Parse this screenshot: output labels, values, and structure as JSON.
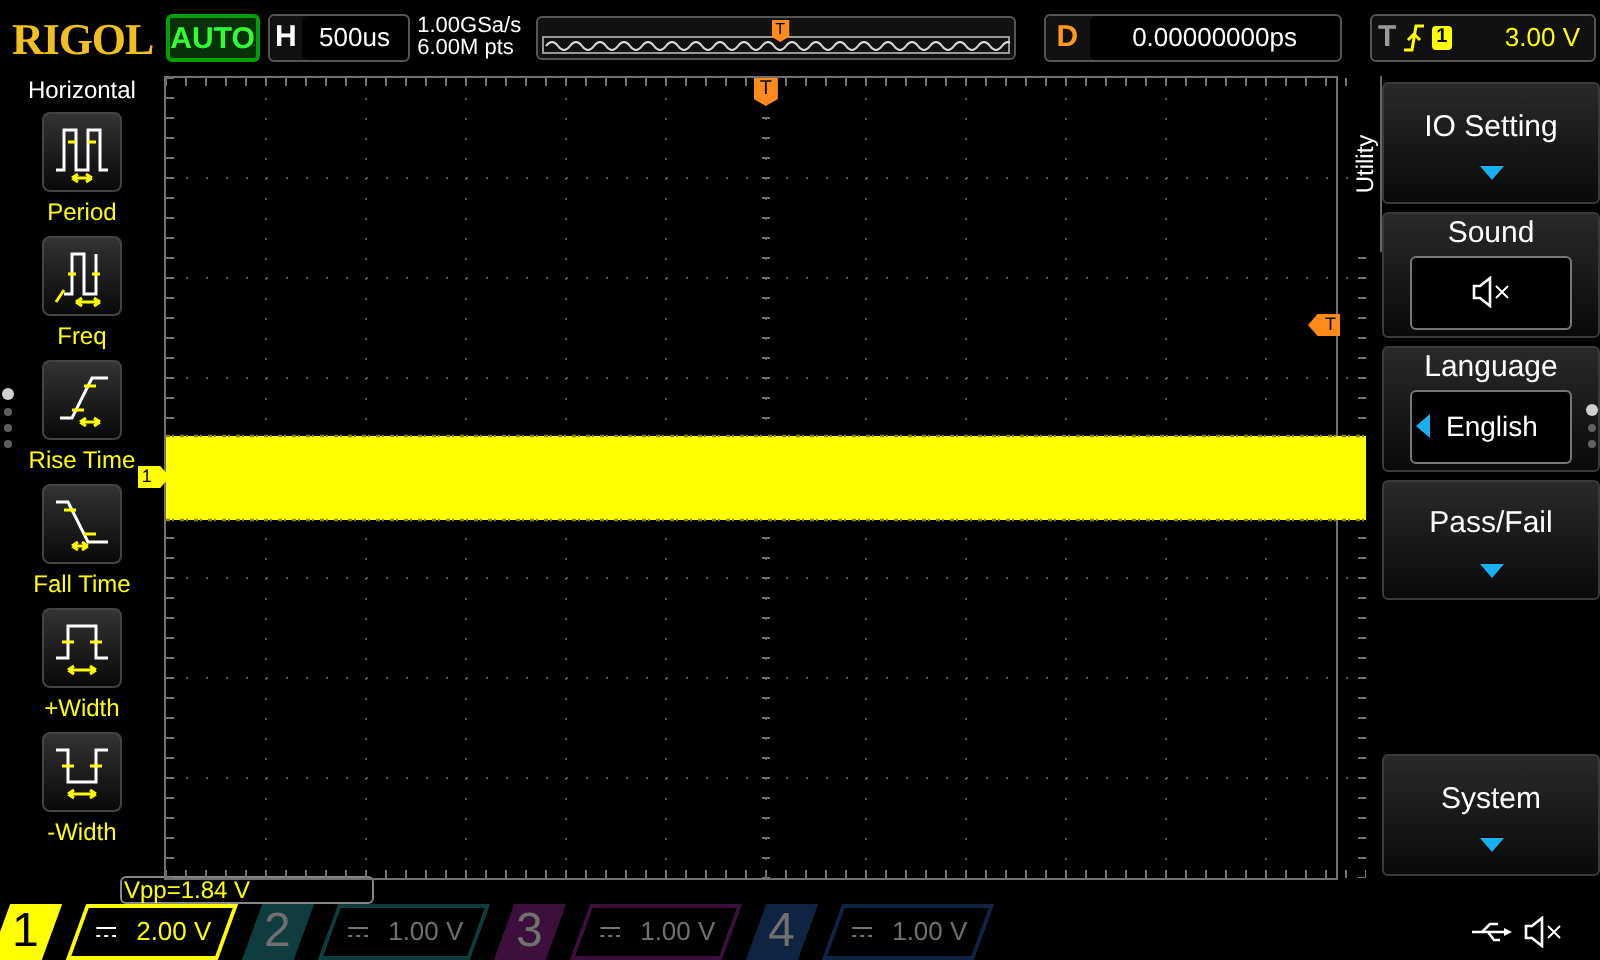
{
  "header": {
    "logo": "RIGOL",
    "run_mode": "AUTO",
    "timebase": {
      "label": "H",
      "value": "500us"
    },
    "sample_rate": "1.00GSa/s",
    "memory_depth": "6.00M pts",
    "trigger_position_marker": "T",
    "delay": {
      "label": "D",
      "value": "0.00000000ps"
    },
    "trigger": {
      "label": "T",
      "source": "1",
      "level": "3.00 V"
    }
  },
  "left_panel": {
    "title": "Horizontal",
    "items": [
      {
        "kind": "period",
        "label": "Period"
      },
      {
        "kind": "freq",
        "label": "Freq"
      },
      {
        "kind": "rise",
        "label": "Rise Time"
      },
      {
        "kind": "fall",
        "label": "Fall Time"
      },
      {
        "kind": "pwidth",
        "label": "+Width"
      },
      {
        "kind": "nwidth",
        "label": "-Width"
      }
    ],
    "page_dots": [
      {
        "selected": true
      },
      {
        "selected": false
      },
      {
        "selected": false
      },
      {
        "selected": false
      }
    ]
  },
  "screen": {
    "top_trigger_marker": "T",
    "level_marker": "T",
    "channel_marker": "1"
  },
  "right_menu": {
    "tab": "Utility",
    "items": [
      {
        "kind": "submenu",
        "label": "IO Setting"
      },
      {
        "kind": "sound",
        "label": "Sound",
        "muted": true
      },
      {
        "kind": "choice",
        "label": "Language",
        "value": "English"
      },
      {
        "kind": "submenu",
        "label": "Pass/Fail"
      },
      {
        "kind": "gap"
      },
      {
        "kind": "submenu",
        "label": "System"
      }
    ],
    "page_dots": [
      {
        "selected": true
      },
      {
        "selected": false
      },
      {
        "selected": false
      }
    ]
  },
  "measurement": "Vpp=1.84 V",
  "channels": [
    {
      "label": "1",
      "scale": "2.00 V",
      "on": true,
      "color": "#ffff00"
    },
    {
      "label": "2",
      "scale": "1.00 V",
      "on": false,
      "color": "#0f3c3c"
    },
    {
      "label": "3",
      "scale": "1.00 V",
      "on": false,
      "color": "#3c0f3c"
    },
    {
      "label": "4",
      "scale": "1.00 V",
      "on": false,
      "color": "#0f2442"
    }
  ],
  "status": {
    "muted": true
  }
}
